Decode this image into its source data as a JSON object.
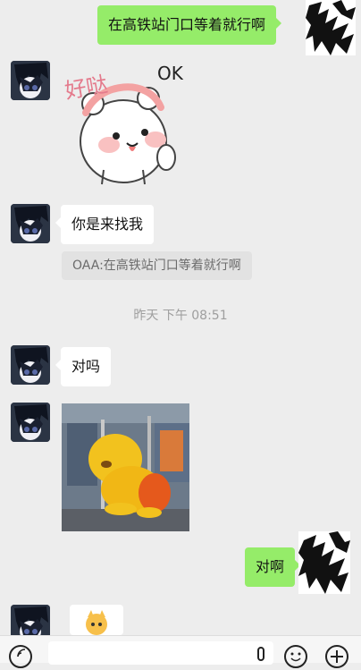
{
  "messages": {
    "m1_text": "在高铁站门口等着就行啊",
    "m2_sticker_text_haoda": "好哒",
    "m2_sticker_text_ok": "OK",
    "m3_text": "你是来找我",
    "m3_quote": "OAA:在高铁站门口等着就行啊",
    "time_divider": "昨天 下午 08:51",
    "m4_text": "对吗",
    "m6_text": "对啊"
  },
  "icons": {
    "voice": "voice-icon",
    "emoji": "emoji-icon",
    "plus": "plus-icon",
    "mic": "mic-icon"
  },
  "colors": {
    "background": "#ededed",
    "bubble_self": "#95ec69",
    "bubble_other": "#ffffff"
  }
}
